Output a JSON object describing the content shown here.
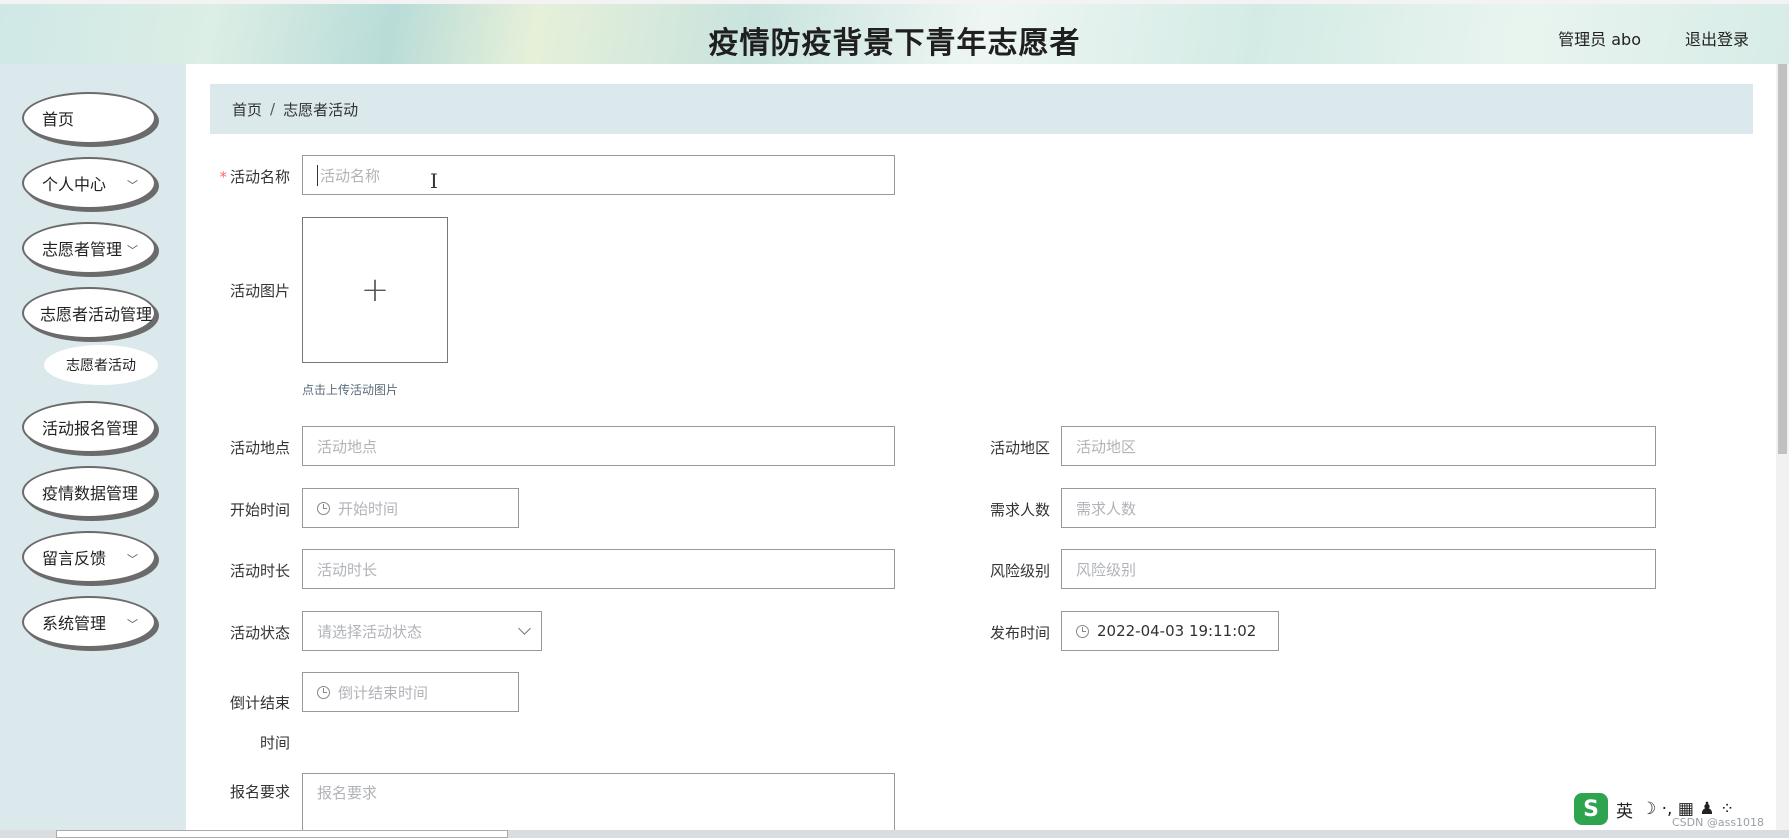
{
  "header": {
    "title": "疫情防疫背景下青年志愿者",
    "user": "管理员 abo",
    "logout": "退出登录"
  },
  "sidebar": {
    "items": [
      {
        "label": "首页",
        "has_chevron": false
      },
      {
        "label": "个人中心",
        "has_chevron": true
      },
      {
        "label": "志愿者管理",
        "has_chevron": true
      },
      {
        "label": "志愿者活动管理",
        "has_chevron": false
      },
      {
        "label": "活动报名管理",
        "has_chevron": false
      },
      {
        "label": "疫情数据管理",
        "has_chevron": false
      },
      {
        "label": "留言反馈",
        "has_chevron": true
      },
      {
        "label": "系统管理",
        "has_chevron": true
      }
    ],
    "sub_item": "志愿者活动"
  },
  "breadcrumb": {
    "home": "首页",
    "separator": "/",
    "current": "志愿者活动"
  },
  "form": {
    "name": {
      "label": "活动名称",
      "placeholder": "活动名称",
      "required": true
    },
    "image": {
      "label": "活动图片",
      "hint": "点击上传活动图片"
    },
    "location": {
      "label": "活动地点",
      "placeholder": "活动地点"
    },
    "region": {
      "label": "活动地区",
      "placeholder": "活动地区"
    },
    "start_time": {
      "label": "开始时间",
      "placeholder": "开始时间"
    },
    "people": {
      "label": "需求人数",
      "placeholder": "需求人数"
    },
    "duration": {
      "label": "活动时长",
      "placeholder": "活动时长"
    },
    "risk": {
      "label": "风险级别",
      "placeholder": "风险级别"
    },
    "status": {
      "label": "活动状态",
      "placeholder": "请选择活动状态"
    },
    "publish_time": {
      "label": "发布时间",
      "value": "2022-04-03 19:11:02"
    },
    "countdown": {
      "label_line1": "倒计结束",
      "label_line2": "时间",
      "placeholder": "倒计结束时间"
    },
    "requirement": {
      "label": "报名要求",
      "placeholder": "报名要求"
    }
  },
  "ime": {
    "logo": "S",
    "lang": "英",
    "icons": "☽ ·, ▦ ♟ ⁘"
  },
  "watermark": "CSDN @ass1018",
  "colors": {
    "accent_bg": "#dce9ec",
    "required": "#f56c6c"
  }
}
